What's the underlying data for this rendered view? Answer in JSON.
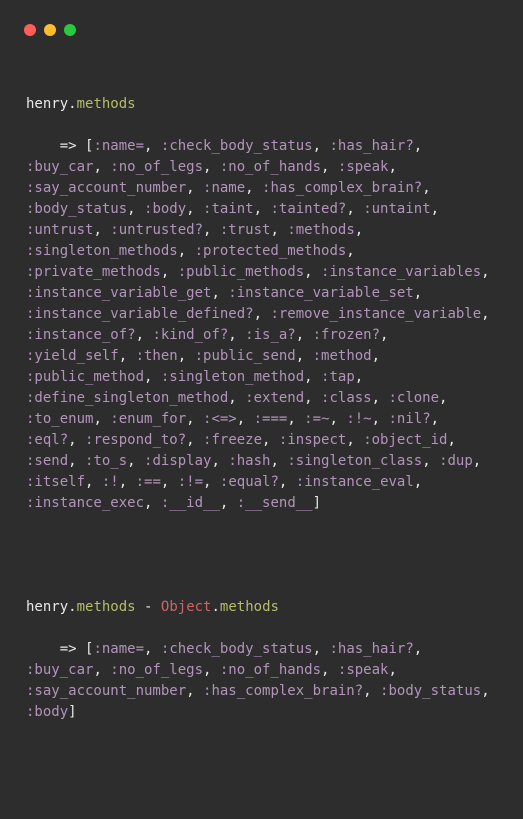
{
  "block1": {
    "receiver": "henry",
    "dot": ".",
    "call": "methods",
    "arrow": "=>",
    "open": "[",
    "close": "]",
    "symbols": [
      ":name=",
      ":check_body_status",
      ":has_hair?",
      ":buy_car",
      ":no_of_legs",
      ":no_of_hands",
      ":speak",
      ":say_account_number",
      ":name",
      ":has_complex_brain?",
      ":body_status",
      ":body",
      ":taint",
      ":tainted?",
      ":untaint",
      ":untrust",
      ":untrusted?",
      ":trust",
      ":methods",
      ":singleton_methods",
      ":protected_methods",
      ":private_methods",
      ":public_methods",
      ":instance_variables",
      ":instance_variable_get",
      ":instance_variable_set",
      ":instance_variable_defined?",
      ":remove_instance_variable",
      ":instance_of?",
      ":kind_of?",
      ":is_a?",
      ":frozen?",
      ":yield_self",
      ":then",
      ":public_send",
      ":method",
      ":public_method",
      ":singleton_method",
      ":tap",
      ":define_singleton_method",
      ":extend",
      ":class",
      ":clone",
      ":to_enum",
      ":enum_for",
      ":<=>",
      ":===",
      ":=~",
      ":!~",
      ":nil?",
      ":eql?",
      ":respond_to?",
      ":freeze",
      ":inspect",
      ":object_id",
      ":send",
      ":to_s",
      ":display",
      ":hash",
      ":singleton_class",
      ":dup",
      ":itself",
      ":!",
      ":==",
      ":!=",
      ":equal?",
      ":instance_eval",
      ":instance_exec",
      ":__id__",
      ":__send__"
    ]
  },
  "block2": {
    "receiver1": "henry",
    "dot": ".",
    "call": "methods",
    "minus": " - ",
    "receiver2": "Object",
    "arrow": "=>",
    "open": "[",
    "close": "]",
    "symbols": [
      ":name=",
      ":check_body_status",
      ":has_hair?",
      ":buy_car",
      ":no_of_legs",
      ":no_of_hands",
      ":speak",
      ":say_account_number",
      ":has_complex_brain?",
      ":body_status",
      ":body"
    ]
  }
}
